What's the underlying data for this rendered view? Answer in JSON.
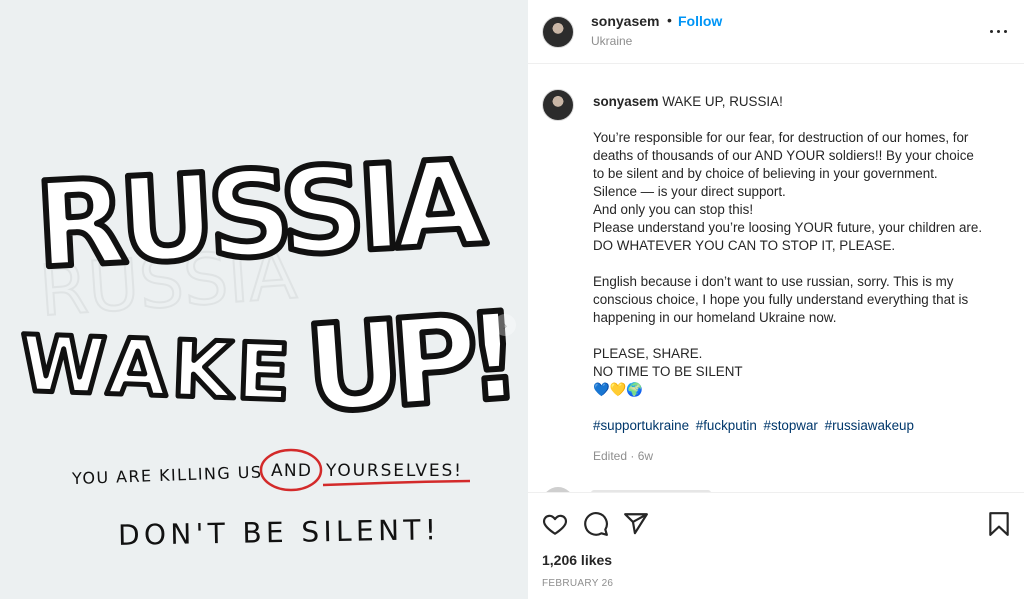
{
  "image": {
    "line1": "RUSSIA",
    "line2a": "WAKE",
    "line2b": "UP!",
    "line3a": "YOU ARE KILLING US",
    "line3b": "AND",
    "line3c": "YOURSELVES!",
    "line4": "DON'T BE SILENT!",
    "colors": {
      "ink": "#111111",
      "accent": "#d32a2a",
      "background": "#ecf0f1"
    }
  },
  "header": {
    "username": "sonyasem",
    "separator": "•",
    "follow_label": "Follow",
    "location": "Ukraine"
  },
  "caption": {
    "username": "sonyasem",
    "title": "WAKE UP, RUSSIA!",
    "para1": [
      "You’re responsible for our fear, for destruction of our homes, for",
      "deaths of thousands of our AND YOUR soldiers!! By your choice",
      "to be silent and by choice of believing in your government.",
      "Silence — is your direct support.",
      "And only you can stop this!",
      "Please understand you’re loosing YOUR future, your children are.",
      "DO WHATEVER YOU CAN TO STOP IT, PLEASE."
    ],
    "para2": [
      "English because i don’t want to use russian, sorry. This is my",
      "conscious choice, I hope you fully understand everything that is",
      "happening in our homeland Ukraine now."
    ],
    "para3": [
      "PLEASE, SHARE.",
      "NO TIME TO BE SILENT",
      "💙💛🌍"
    ],
    "hashtags": [
      "#supportukraine",
      "#fuckputin",
      "#stopwar",
      "#russiawakeup"
    ],
    "edited": "Edited · 6w"
  },
  "actions": {
    "icons": [
      "heart-icon",
      "comment-icon",
      "share-icon",
      "bookmark-icon"
    ],
    "likes": "1,206 likes",
    "date": "FEBRUARY 26"
  },
  "accent_color": "#0095f6"
}
